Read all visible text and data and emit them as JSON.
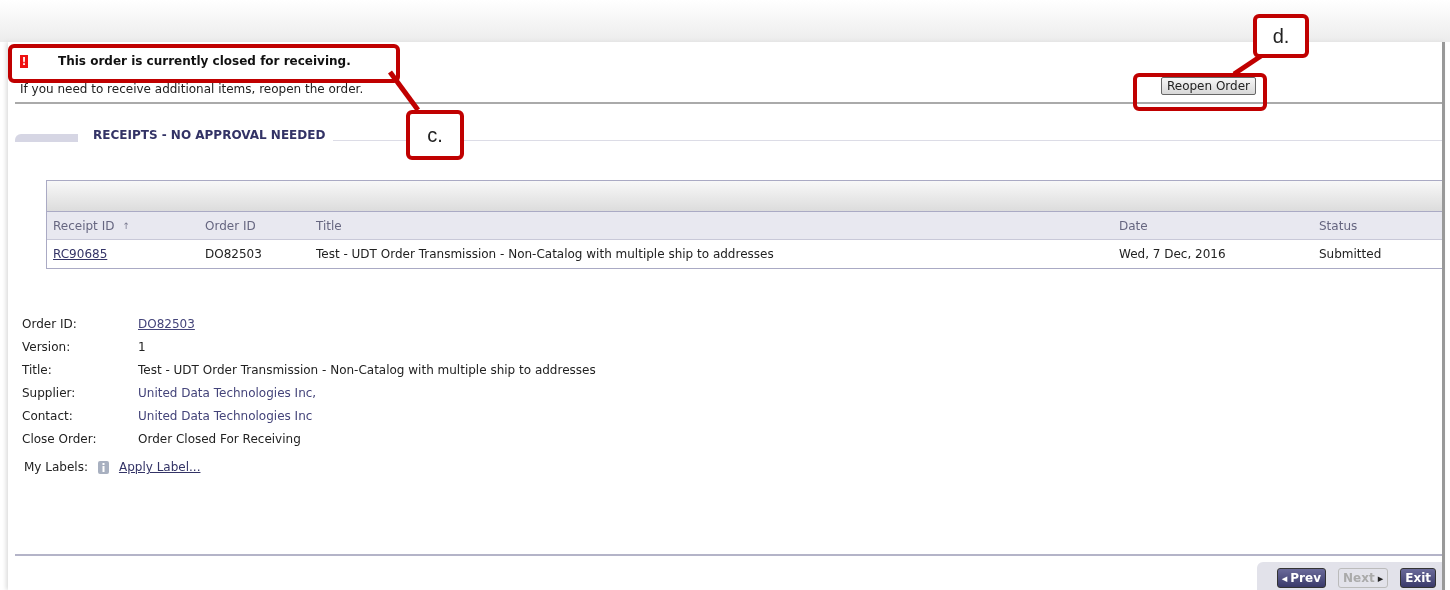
{
  "alert": {
    "icon": "!",
    "message": "This order is currently closed for receiving.",
    "hint": "If you need to receive additional items, reopen the order."
  },
  "reopen_button": "Reopen Order",
  "section": {
    "title": "RECEIPTS - NO APPROVAL NEEDED"
  },
  "table": {
    "columns": [
      {
        "label": "Receipt ID",
        "sort_mark": "↑"
      },
      {
        "label": "Order ID"
      },
      {
        "label": "Title"
      },
      {
        "label": "Date"
      },
      {
        "label": "Status"
      }
    ],
    "rows": [
      {
        "cells": [
          "RC90685",
          "DO82503",
          "Test - UDT Order Transmission - Non-Catalog with multiple ship to addresses",
          "Wed, 7 Dec, 2016",
          "Submitted"
        ]
      }
    ]
  },
  "details": [
    {
      "label": "Order ID:",
      "value": "DO82503",
      "kind": "link"
    },
    {
      "label": "Version:",
      "value": "1",
      "kind": "text"
    },
    {
      "label": "Title:",
      "value": "Test - UDT Order Transmission - Non-Catalog with multiple ship to addresses",
      "kind": "text"
    },
    {
      "label": "Supplier:",
      "value": "United Data Technologies Inc,",
      "kind": "name"
    },
    {
      "label": "Contact:",
      "value": "United Data Technologies Inc",
      "kind": "name"
    },
    {
      "label": "Close Order:",
      "value": "Order Closed For Receiving",
      "kind": "text"
    }
  ],
  "labels": {
    "label": "My Labels:",
    "action": "Apply Label..."
  },
  "footer_buttons": [
    {
      "label": "Prev",
      "disabled": false,
      "arrow_before": "◂"
    },
    {
      "label": "Next",
      "disabled": true,
      "arrow_after": "▸"
    },
    {
      "label": "Exit",
      "disabled": false
    }
  ],
  "callouts": [
    {
      "label": "c."
    },
    {
      "label": "d."
    }
  ]
}
